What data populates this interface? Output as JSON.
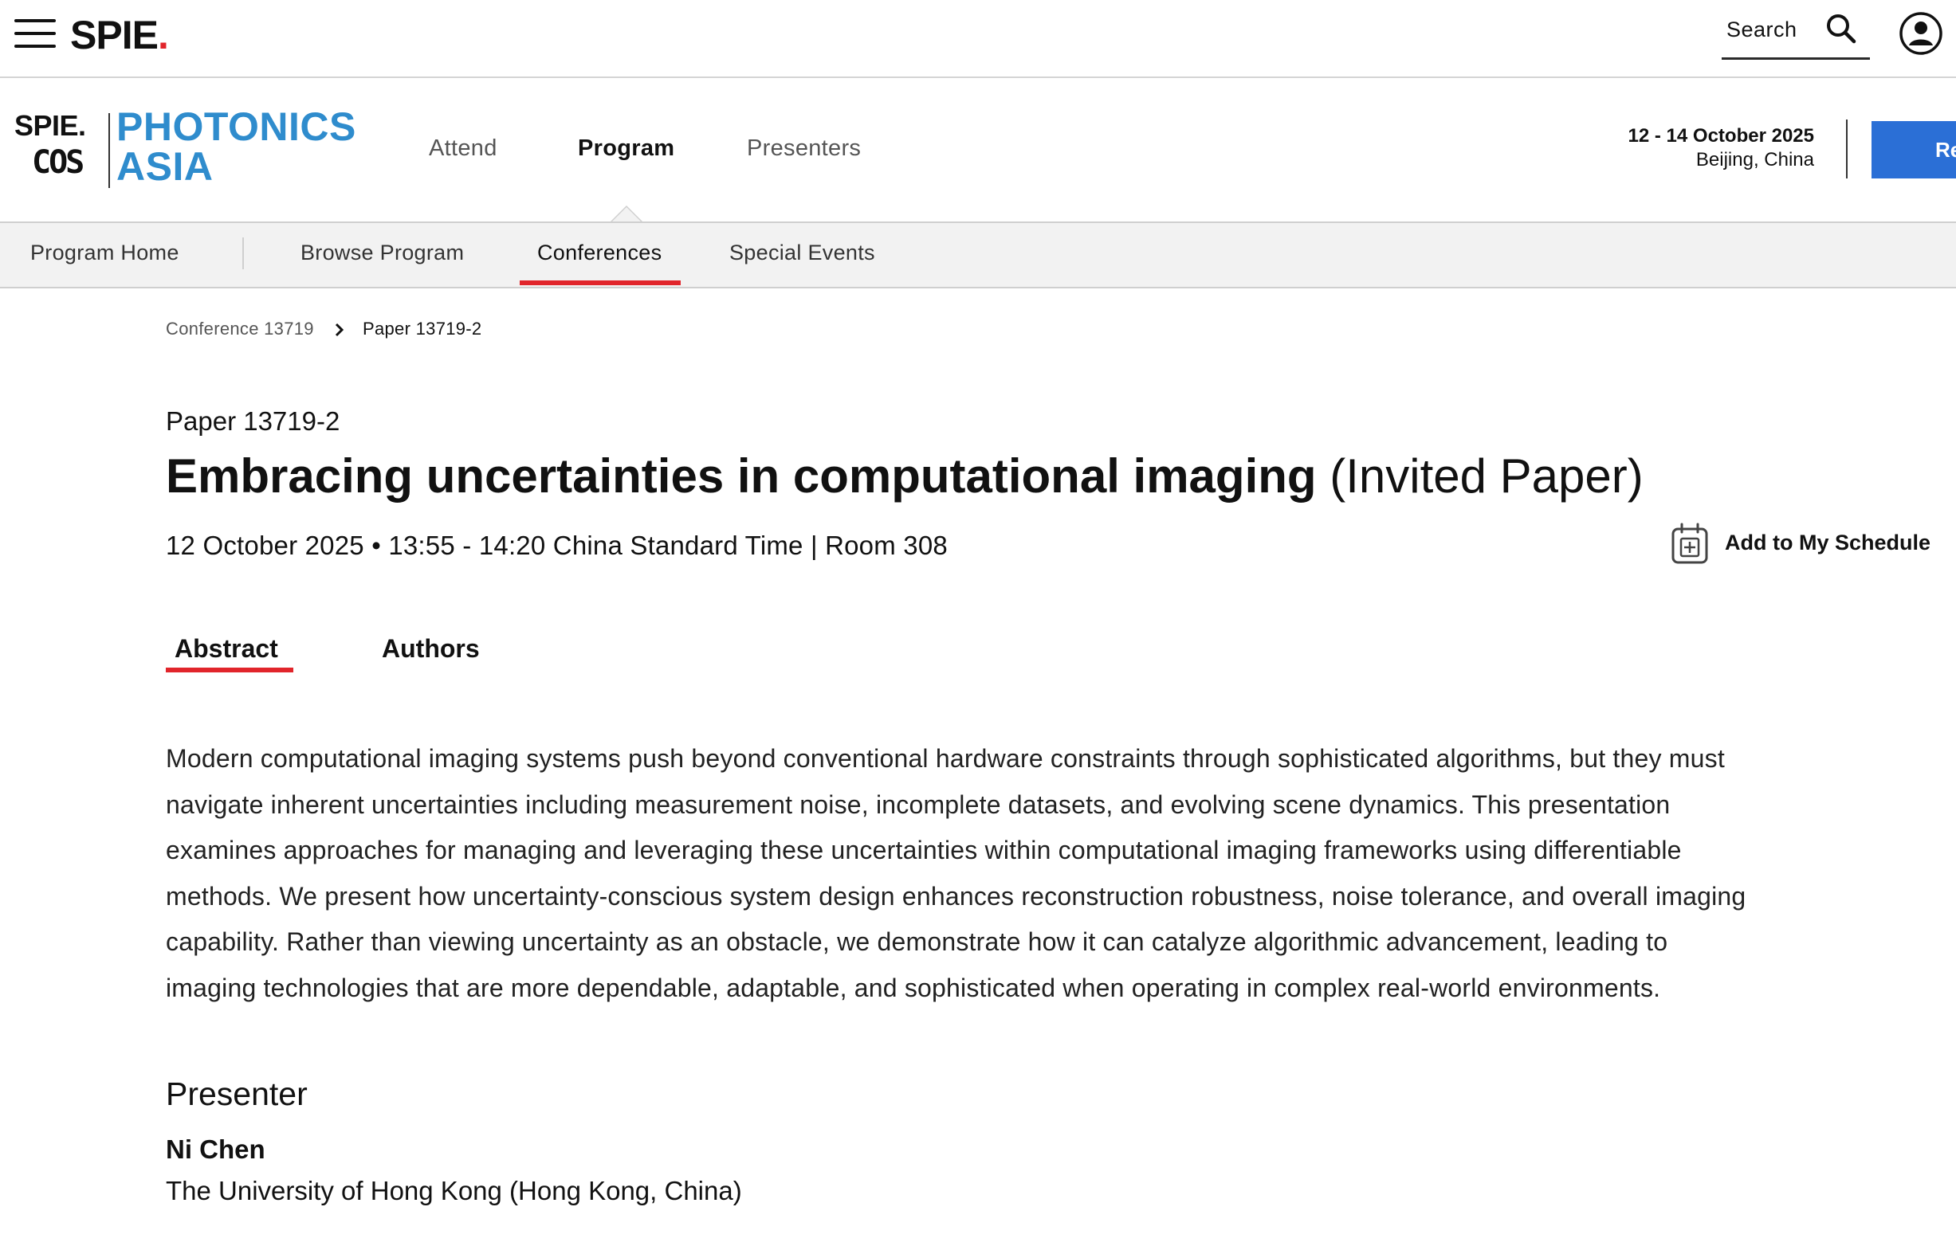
{
  "topbar": {
    "brand": "SPIE",
    "brand_dot": ".",
    "search_label": "Search",
    "icons": {
      "menu": "hamburger-menu-icon",
      "search": "search-icon",
      "user": "user-account-icon"
    }
  },
  "event": {
    "org_logo": "SPIE.",
    "partner_logo": "COS",
    "name_line1": "PHOTONICS",
    "name_line2": "ASIA",
    "nav": [
      {
        "label": "Attend",
        "active": false
      },
      {
        "label": "Program",
        "active": true
      },
      {
        "label": "Presenters",
        "active": false
      }
    ],
    "dates": "12 - 14 October 2025",
    "location": "Beijing, China",
    "register_label": "Re",
    "colors": {
      "brand_blue": "#2f8ccd",
      "button_blue": "#2b6fd6",
      "accent_red": "#e1252b"
    }
  },
  "subnav": [
    {
      "label": "Program Home",
      "active": false
    },
    {
      "label": "Browse Program",
      "active": false
    },
    {
      "label": "Conferences",
      "active": true
    },
    {
      "label": "Special Events",
      "active": false
    }
  ],
  "breadcrumb": {
    "parent": "Conference 13719",
    "current": "Paper 13719-2",
    "separator_icon": "chevron-right-icon"
  },
  "paper": {
    "number": "Paper 13719-2",
    "title": "Embracing uncertainties in computational imaging",
    "title_suffix": "(Invited Paper)",
    "meta": "12 October 2025 • 13:55 - 14:20 China Standard Time | Room 308",
    "schedule_label": "Add to My Schedule",
    "schedule_icon": "calendar-add-icon"
  },
  "tabs": [
    {
      "label": "Abstract",
      "active": true
    },
    {
      "label": "Authors",
      "active": false
    }
  ],
  "abstract": {
    "lines": [
      "Modern computational imaging systems push beyond conventional hardware constraints through sophisticated algorithms, but they must",
      "navigate inherent uncertainties including measurement noise, incomplete datasets, and evolving scene dynamics. This presentation",
      "examines approaches for managing and leveraging these uncertainties within computational imaging frameworks using differentiable",
      "methods. We present how uncertainty-conscious system design enhances reconstruction robustness, noise tolerance, and overall imaging",
      "capability. Rather than viewing uncertainty as an obstacle, we demonstrate how it can catalyze algorithmic advancement, leading to",
      "imaging technologies that are more dependable, adaptable, and sophisticated when operating in complex real-world environments."
    ]
  },
  "presenter": {
    "heading": "Presenter",
    "name": "Ni Chen",
    "affiliation": "The University of Hong Kong (Hong Kong, China)"
  }
}
